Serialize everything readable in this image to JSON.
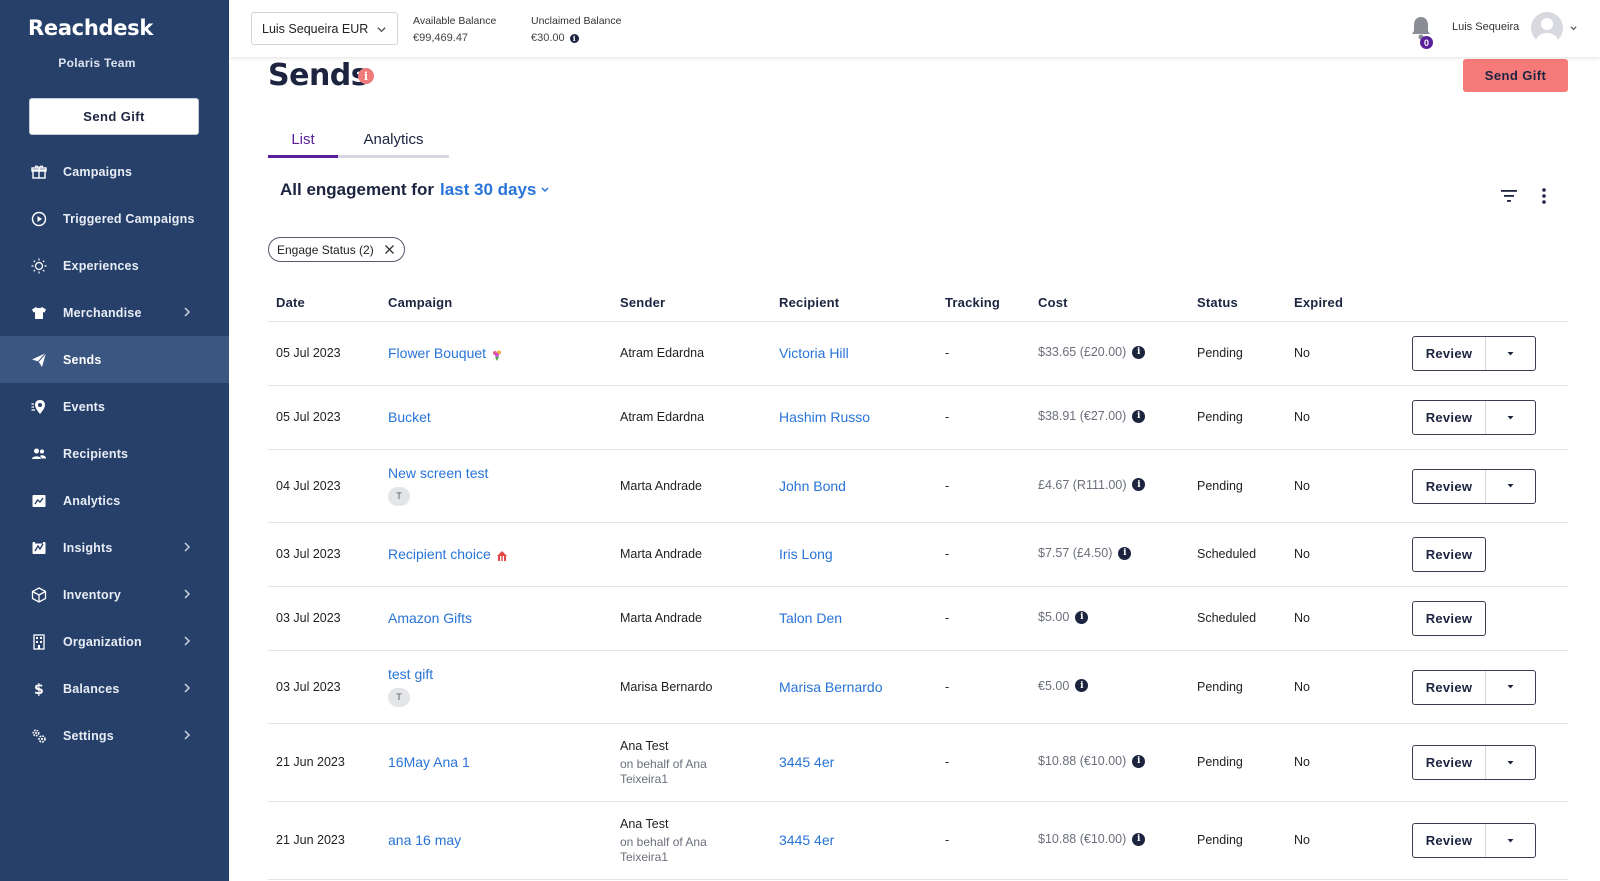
{
  "sidebar": {
    "logo": "Reachdesk",
    "team": "Polaris Team",
    "send_gift": "Send Gift",
    "items": [
      {
        "label": "Campaigns",
        "icon": "gift-icon",
        "chevron": false
      },
      {
        "label": "Triggered Campaigns",
        "icon": "play-circle-icon",
        "chevron": false
      },
      {
        "label": "Experiences",
        "icon": "lightbulb-icon",
        "chevron": false
      },
      {
        "label": "Merchandise",
        "icon": "tshirt-icon",
        "chevron": true
      },
      {
        "label": "Sends",
        "icon": "paper-plane-icon",
        "chevron": false,
        "active": true
      },
      {
        "label": "Events",
        "icon": "location-pin-icon",
        "chevron": false
      },
      {
        "label": "Recipients",
        "icon": "users-icon",
        "chevron": false
      },
      {
        "label": "Analytics",
        "icon": "analytics-icon",
        "chevron": false
      },
      {
        "label": "Insights",
        "icon": "insights-icon",
        "chevron": true
      },
      {
        "label": "Inventory",
        "icon": "box-icon",
        "chevron": true
      },
      {
        "label": "Organization",
        "icon": "building-icon",
        "chevron": true
      },
      {
        "label": "Balances",
        "icon": "dollar-icon",
        "chevron": true
      },
      {
        "label": "Settings",
        "icon": "gears-icon",
        "chevron": true
      }
    ]
  },
  "topbar": {
    "account": "Luis Sequeira EUR",
    "available_label": "Available Balance",
    "available_value": "€99,469.47",
    "unclaimed_label": "Unclaimed Balance",
    "unclaimed_value": "€30.00",
    "notifications": "0",
    "username": "Luis Sequeira"
  },
  "page": {
    "title": "Sends",
    "send_gift": "Send Gift",
    "tabs": [
      "List",
      "Analytics"
    ],
    "engage_prefix": "All engagement for",
    "engage_range": "last 30 days",
    "chip": "Engage Status (2)"
  },
  "table": {
    "headers": [
      "Date",
      "Campaign",
      "Sender",
      "Recipient",
      "Tracking",
      "Cost",
      "Status",
      "Expired"
    ],
    "review_label": "Review",
    "rows": [
      {
        "date": "05 Jul 2023",
        "campaign": "Flower Bouquet",
        "emoji": "bouquet",
        "tag": "",
        "sender": "Atram Edardna",
        "sender_sub1": "",
        "sender_sub2": "",
        "recipient": "Victoria Hill",
        "tracking": "-",
        "cost": "$33.65 (£20.00)",
        "status": "Pending",
        "expired": "No",
        "dropdown": true
      },
      {
        "date": "05 Jul 2023",
        "campaign": "Bucket",
        "emoji": "",
        "tag": "",
        "sender": "Atram Edardna",
        "sender_sub1": "",
        "sender_sub2": "",
        "recipient": "Hashim Russo",
        "tracking": "-",
        "cost": "$38.91 (€27.00)",
        "status": "Pending",
        "expired": "No",
        "dropdown": true
      },
      {
        "date": "04 Jul 2023",
        "campaign": "New screen test",
        "emoji": "",
        "tag": "T",
        "sender": "Marta Andrade",
        "sender_sub1": "",
        "sender_sub2": "",
        "recipient": "John Bond",
        "tracking": "-",
        "cost": "£4.67 (R111.00)",
        "status": "Pending",
        "expired": "No",
        "dropdown": true
      },
      {
        "date": "03 Jul 2023",
        "campaign": "Recipient choice",
        "emoji": "circus",
        "tag": "",
        "sender": "Marta Andrade",
        "sender_sub1": "",
        "sender_sub2": "",
        "recipient": "Iris Long",
        "tracking": "-",
        "cost": "$7.57 (£4.50)",
        "status": "Scheduled",
        "expired": "No",
        "dropdown": false
      },
      {
        "date": "03 Jul 2023",
        "campaign": "Amazon Gifts",
        "emoji": "",
        "tag": "",
        "sender": "Marta Andrade",
        "sender_sub1": "",
        "sender_sub2": "",
        "recipient": "Talon Den",
        "tracking": "-",
        "cost": "$5.00",
        "status": "Scheduled",
        "expired": "No",
        "dropdown": false
      },
      {
        "date": "03 Jul 2023",
        "campaign": "test gift",
        "emoji": "",
        "tag": "T",
        "sender": "Marisa Bernardo",
        "sender_sub1": "",
        "sender_sub2": "",
        "recipient": "Marisa Bernardo",
        "tracking": "-",
        "cost": "€5.00",
        "status": "Pending",
        "expired": "No",
        "dropdown": true
      },
      {
        "date": "21 Jun 2023",
        "campaign": "16May Ana 1",
        "emoji": "",
        "tag": "",
        "sender": "Ana Test",
        "sender_sub1": "on behalf of Ana",
        "sender_sub2": "Teixeira1",
        "recipient": "3445 4er",
        "tracking": "-",
        "cost": "$10.88 (€10.00)",
        "status": "Pending",
        "expired": "No",
        "dropdown": true
      },
      {
        "date": "21 Jun 2023",
        "campaign": "ana 16 may",
        "emoji": "",
        "tag": "",
        "sender": "Ana Test",
        "sender_sub1": "on behalf of Ana",
        "sender_sub2": "Teixeira1",
        "recipient": "3445 4er",
        "tracking": "-",
        "cost": "$10.88 (€10.00)",
        "status": "Pending",
        "expired": "No",
        "dropdown": true
      }
    ]
  },
  "colors": {
    "sidebar": "#27406a",
    "sidebar_active": "#3c5682",
    "accent_purple": "#5a1f9a",
    "link_blue": "#2874d8",
    "send_gift_red": "#f77a7a"
  }
}
